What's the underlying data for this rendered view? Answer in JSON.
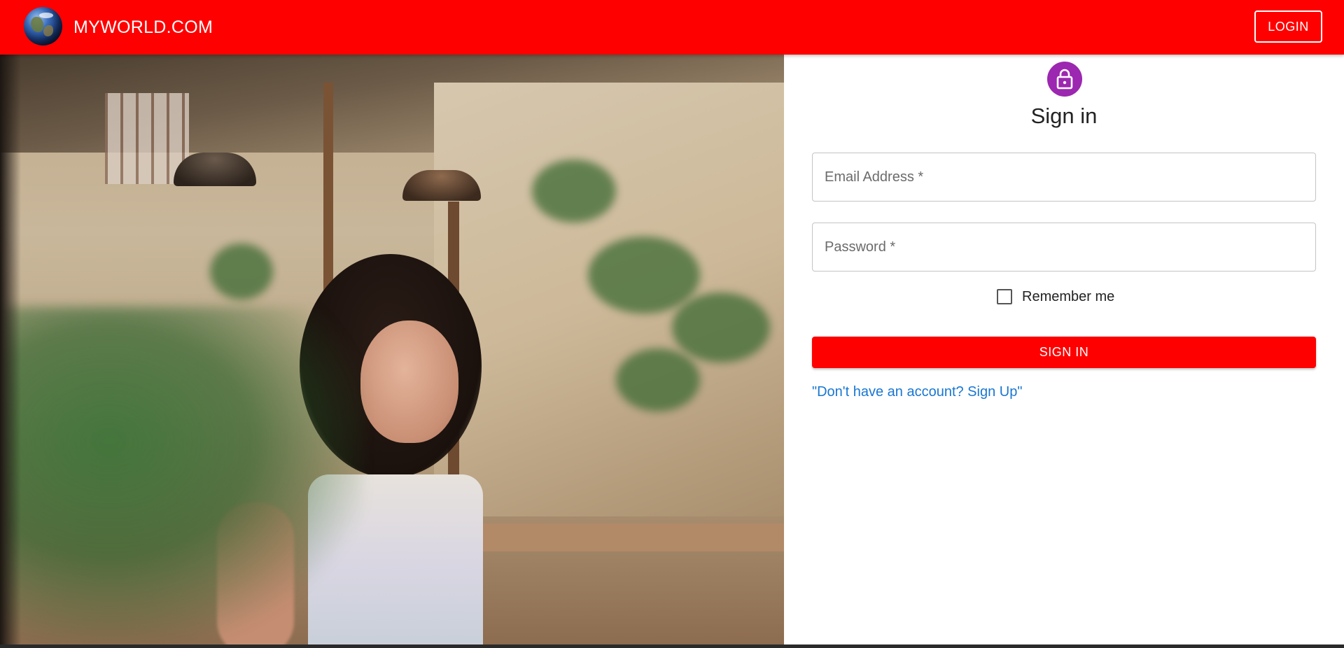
{
  "appbar": {
    "brand": "MYWORLD.COM",
    "logo_icon": "globe-icon",
    "login_label": "LOGIN",
    "background_color": "#ff0000"
  },
  "hero_image": {
    "icon": "photo-woman-indoors"
  },
  "signin": {
    "avatar_icon": "lock-icon",
    "avatar_color": "#9c27b0",
    "title": "Sign in",
    "email_placeholder": "Email Address *",
    "email_value": "",
    "password_placeholder": "Password *",
    "password_value": "",
    "remember_label": "Remember me",
    "remember_checked": false,
    "submit_label": "SIGN IN",
    "signup_link": "\"Don't have an account? Sign Up\"",
    "link_color": "#1976d2"
  }
}
